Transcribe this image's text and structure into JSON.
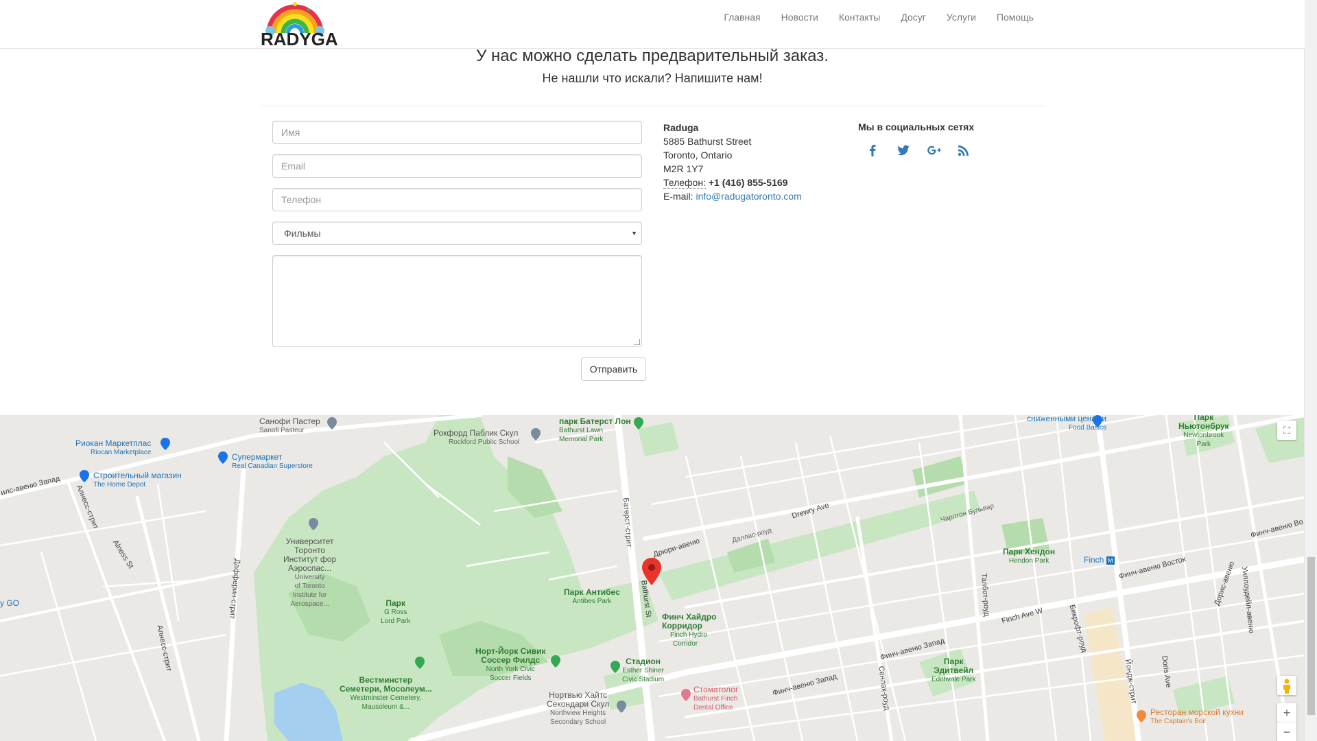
{
  "brand": {
    "name": "RADYGA"
  },
  "nav": {
    "items": [
      {
        "label": "Главная"
      },
      {
        "label": "Новости"
      },
      {
        "label": "Контакты"
      },
      {
        "label": "Досуг"
      },
      {
        "label": "Услуги"
      },
      {
        "label": "Помощь"
      }
    ]
  },
  "headings": {
    "main": "У нас можно сделать предварительный заказ.",
    "sub": "Не нашли что искали? Напишите нам!"
  },
  "form": {
    "name_placeholder": "Имя",
    "email_placeholder": "Email",
    "phone_placeholder": "Телефон",
    "select_value": "Фильмы",
    "message_value": "",
    "submit_label": "Отправить"
  },
  "contact": {
    "company": "Raduga",
    "street": "5885 Bathurst Street",
    "city": "Toronto, Ontario",
    "postal": "M2R 1Y7",
    "phone_label": "Телефон:",
    "phone": "+1 (416) 855-5169",
    "email_label": "E-mail:",
    "email": "info@radugatoronto.com"
  },
  "social": {
    "title": "Мы в социальных сетях",
    "icons": [
      "facebook-icon",
      "twitter-icon",
      "google-plus-icon",
      "rss-icon"
    ],
    "color": "#337ab7"
  },
  "map": {
    "places": {
      "sanofi": {
        "name": "Санофи Пастер",
        "sub": "Sanofi Pasteur"
      },
      "bathurst_lawn": {
        "name": "парк Батерст Лон",
        "sub1": "Bathurst Lawn",
        "sub2": "Memorial Park"
      },
      "rockford": {
        "name": "Рокфорд Паблик Скул",
        "sub": "Rockford Public School"
      },
      "riocan": {
        "name": "Риокан Маркетплас",
        "sub": "Riocan Marketplace"
      },
      "superstore": {
        "name": "Супермаркет",
        "sub": "Real Canadian Superstore"
      },
      "home_depot": {
        "name": "Строительный магазин",
        "sub": "The Home Depot"
      },
      "university": {
        "name1": "Университет",
        "name2": "Торонто",
        "name3": "Институт фор",
        "name4": "Аэроспас...",
        "sub1": "University",
        "sub2": "of Toronto",
        "sub3": "Institute for",
        "sub4": "Aerospace..."
      },
      "g_ross": {
        "name": "Парк",
        "sub1": "G Ross",
        "sub2": "Lord Park"
      },
      "antibes": {
        "name": "Парк Антибес",
        "sub": "Antibes Park"
      },
      "hydro": {
        "name1": "Финч Хайдро",
        "name2": "Корридор",
        "sub1": "Finch Hydro",
        "sub2": "Corridor"
      },
      "soccer": {
        "name1": "Норт-Йорк Сивик",
        "name2": "Соссер Филдс",
        "sub1": "North York Civic",
        "sub2": "Soccer Fields"
      },
      "stadium": {
        "name": "Стадион",
        "sub1": "Esther Shiner",
        "sub2": "Civic Stadium"
      },
      "westminster": {
        "name1": "Вестминстер",
        "name2": "Семетери, Мосолеум...",
        "sub1": "Westminster Cemetery,",
        "sub2": "Mausoleum &..."
      },
      "northview": {
        "name1": "Нортвью Хайтс",
        "name2": "Секондари Скул",
        "sub1": "Northview Heights",
        "sub2": "Secondary School"
      },
      "dentist": {
        "name": "Стоматолог",
        "sub1": "Bathurst Finch",
        "sub2": "Dental Office"
      },
      "hendon": {
        "name": "Парк Хендон",
        "sub": "Hendon Park"
      },
      "edithvale": {
        "name1": "Парк",
        "name2": "Эдитвейл",
        "sub": "Edithvale Park"
      },
      "newtonbrook": {
        "name1": "Парк",
        "name2": "Ньютонбрук",
        "sub1": "Newtonbrook",
        "sub2": "Park"
      },
      "food_basics": {
        "name": "сниженными ценами",
        "sub": "Food Basics"
      },
      "finch_station": {
        "name": "Finch"
      },
      "captains_boil": {
        "name": "Ресторан морской кухни",
        "sub": "The Captain's Boil"
      },
      "go": {
        "name": "y GO"
      }
    },
    "streets": {
      "bathurst": "Батерст-стрит",
      "bathurst_st": "Bathurst St",
      "drewry": "Drewry Ave",
      "drewry_ru": "Дрюри-авеню",
      "finch_w": "Finch Ave W",
      "finch_west": "Финч-авеню Запад",
      "finch_west2": "Финч-авеню Запад",
      "finch_east": "Финч-авеню Восток",
      "dufferin": "Дафферин-стрит",
      "alness": "Алнесс-стрит",
      "alness_st": "Alness St",
      "alness2": "Алнесс-стрит",
      "allness_west": "илс-авеню Запад",
      "senlac": "Сенлак-роуд",
      "talbot": "Талбот-роуд",
      "yonge": "Йондж-стрит",
      "finch_ave": "Финч-авеню",
      "doris": "Дорис-авеню",
      "doris_ave": "Doris Ave",
      "welbeck": "Бейкер-авеню",
      "charlton": "Чарлтон Бульвар",
      "dallas": "Даллас-роуд",
      "beecroft": "Бикрофт-роуд",
      "yonge_ave": "Уиллоудейл-авеню",
      "finch_ave_e": "Финч-авеню Во"
    }
  }
}
